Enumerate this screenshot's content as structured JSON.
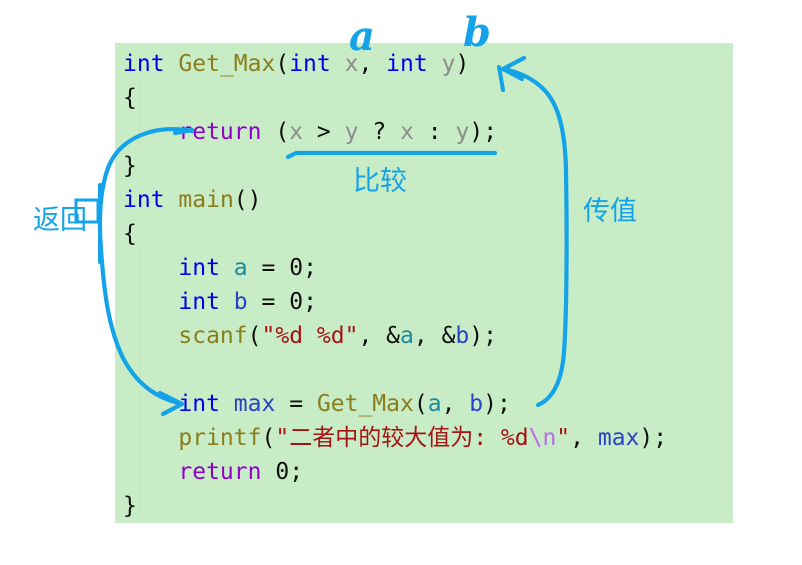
{
  "document": {
    "kind": "code-screenshot",
    "language": "C",
    "panel_background": "#c8ecc5",
    "annotation_color": "#14a3e8"
  },
  "code": {
    "lines": [
      {
        "id": "line-1",
        "text": "int Get_Max(int x, int y)",
        "tokens": [
          {
            "t": "int",
            "c": "kw"
          },
          {
            "t": " ",
            "c": "punct"
          },
          {
            "t": "Get_Max",
            "c": "fn"
          },
          {
            "t": "(",
            "c": "punct"
          },
          {
            "t": "int",
            "c": "kw"
          },
          {
            "t": " ",
            "c": "punct"
          },
          {
            "t": "x",
            "c": "var-gray"
          },
          {
            "t": ", ",
            "c": "punct"
          },
          {
            "t": "int",
            "c": "kw"
          },
          {
            "t": " ",
            "c": "punct"
          },
          {
            "t": "y",
            "c": "var-gray"
          },
          {
            "t": ")",
            "c": "punct"
          }
        ]
      },
      {
        "id": "line-2",
        "text": "{",
        "tokens": [
          {
            "t": "{",
            "c": "punct"
          }
        ]
      },
      {
        "id": "line-3",
        "text": "    return (x > y ? x : y);",
        "tokens": [
          {
            "t": "    ",
            "c": "punct"
          },
          {
            "t": "return",
            "c": "kw2"
          },
          {
            "t": " ",
            "c": "punct"
          },
          {
            "t": "(",
            "c": "punct"
          },
          {
            "t": "x",
            "c": "var-gray"
          },
          {
            "t": " ",
            "c": "punct"
          },
          {
            "t": ">",
            "c": "op"
          },
          {
            "t": " ",
            "c": "punct"
          },
          {
            "t": "y",
            "c": "var-gray"
          },
          {
            "t": " ",
            "c": "punct"
          },
          {
            "t": "?",
            "c": "op"
          },
          {
            "t": " ",
            "c": "punct"
          },
          {
            "t": "x",
            "c": "var-gray"
          },
          {
            "t": " ",
            "c": "punct"
          },
          {
            "t": ":",
            "c": "op"
          },
          {
            "t": " ",
            "c": "punct"
          },
          {
            "t": "y",
            "c": "var-gray"
          },
          {
            "t": ");",
            "c": "punct"
          }
        ]
      },
      {
        "id": "line-4",
        "text": "}",
        "tokens": [
          {
            "t": "}",
            "c": "punct"
          }
        ]
      },
      {
        "id": "line-5",
        "text": "int main()",
        "tokens": [
          {
            "t": "int",
            "c": "kw"
          },
          {
            "t": " ",
            "c": "punct"
          },
          {
            "t": "main",
            "c": "fn"
          },
          {
            "t": "()",
            "c": "punct"
          }
        ]
      },
      {
        "id": "line-6",
        "text": "{",
        "tokens": [
          {
            "t": "{",
            "c": "punct"
          }
        ]
      },
      {
        "id": "line-7",
        "text": "    int a = 0;",
        "tokens": [
          {
            "t": "    ",
            "c": "punct"
          },
          {
            "t": "int",
            "c": "kw"
          },
          {
            "t": " ",
            "c": "punct"
          },
          {
            "t": "a",
            "c": "var-a"
          },
          {
            "t": " ",
            "c": "punct"
          },
          {
            "t": "=",
            "c": "op"
          },
          {
            "t": " ",
            "c": "punct"
          },
          {
            "t": "0",
            "c": "num"
          },
          {
            "t": ";",
            "c": "punct"
          }
        ]
      },
      {
        "id": "line-8",
        "text": "    int b = 0;",
        "tokens": [
          {
            "t": "    ",
            "c": "punct"
          },
          {
            "t": "int",
            "c": "kw"
          },
          {
            "t": " ",
            "c": "punct"
          },
          {
            "t": "b",
            "c": "var-b"
          },
          {
            "t": " ",
            "c": "punct"
          },
          {
            "t": "=",
            "c": "op"
          },
          {
            "t": " ",
            "c": "punct"
          },
          {
            "t": "0",
            "c": "num"
          },
          {
            "t": ";",
            "c": "punct"
          }
        ]
      },
      {
        "id": "line-9",
        "text": "    scanf(\"%d %d\", &a, &b);",
        "tokens": [
          {
            "t": "    ",
            "c": "punct"
          },
          {
            "t": "scanf",
            "c": "fn"
          },
          {
            "t": "(",
            "c": "punct"
          },
          {
            "t": "\"%d %d\"",
            "c": "str"
          },
          {
            "t": ", ",
            "c": "punct"
          },
          {
            "t": "&",
            "c": "punct"
          },
          {
            "t": "a",
            "c": "var-a"
          },
          {
            "t": ", ",
            "c": "punct"
          },
          {
            "t": "&",
            "c": "punct"
          },
          {
            "t": "b",
            "c": "var-b"
          },
          {
            "t": ");",
            "c": "punct"
          }
        ]
      },
      {
        "id": "line-10",
        "text": "",
        "tokens": []
      },
      {
        "id": "line-11",
        "text": "    int max = Get_Max(a, b);",
        "tokens": [
          {
            "t": "    ",
            "c": "punct"
          },
          {
            "t": "int",
            "c": "kw"
          },
          {
            "t": " ",
            "c": "punct"
          },
          {
            "t": "max",
            "c": "var-max"
          },
          {
            "t": " ",
            "c": "punct"
          },
          {
            "t": "=",
            "c": "op"
          },
          {
            "t": " ",
            "c": "punct"
          },
          {
            "t": "Get_Max",
            "c": "fn"
          },
          {
            "t": "(",
            "c": "punct"
          },
          {
            "t": "a",
            "c": "var-a"
          },
          {
            "t": ", ",
            "c": "punct"
          },
          {
            "t": "b",
            "c": "var-b"
          },
          {
            "t": ");",
            "c": "punct"
          }
        ]
      },
      {
        "id": "line-12",
        "text": "    printf(\"二者中的较大值为: %d\\n\", max);",
        "tokens": [
          {
            "t": "    ",
            "c": "punct"
          },
          {
            "t": "printf",
            "c": "fn"
          },
          {
            "t": "(",
            "c": "punct"
          },
          {
            "t": "\"二者中的较大值为: %d",
            "c": "str"
          },
          {
            "t": "\\n",
            "c": "esc"
          },
          {
            "t": "\"",
            "c": "str"
          },
          {
            "t": ", ",
            "c": "punct"
          },
          {
            "t": "max",
            "c": "var-max"
          },
          {
            "t": ");",
            "c": "punct"
          }
        ]
      },
      {
        "id": "line-13",
        "text": "    return 0;",
        "tokens": [
          {
            "t": "    ",
            "c": "punct"
          },
          {
            "t": "return",
            "c": "kw2"
          },
          {
            "t": " ",
            "c": "punct"
          },
          {
            "t": "0",
            "c": "num"
          },
          {
            "t": ";",
            "c": "punct"
          }
        ]
      },
      {
        "id": "line-14",
        "text": "}",
        "tokens": [
          {
            "t": "}",
            "c": "punct"
          }
        ]
      }
    ]
  },
  "annotations": {
    "return_label": "返回",
    "compare_label": "比较",
    "passvalue_label": "传值",
    "hand_a": "a",
    "hand_b": "b"
  }
}
